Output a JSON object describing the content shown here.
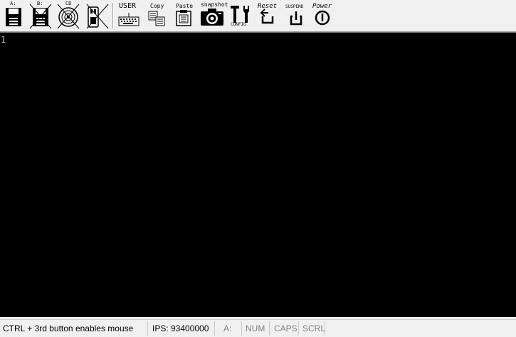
{
  "toolbar": {
    "floppy_a_label": "A:",
    "floppy_b_label": "B:",
    "cdrom_label": "CD",
    "user_label": "USER",
    "copy_label": "Copy",
    "paste_label": "Paste",
    "snapshot_label": "snapshot",
    "config_label": "CONFIG",
    "reset_label": "Reset",
    "suspend_label": "SUSPEND",
    "power_label": "Power"
  },
  "console": {
    "cursor": "1"
  },
  "statusbar": {
    "message": "CTRL + 3rd button enables mouse",
    "ips": "IPS: 93400000",
    "drive_indicator": "A:",
    "num_lock": "NUM",
    "caps_lock": "CAPS",
    "scroll_lock": "SCRL"
  },
  "colors": {
    "screen_background": "#000000",
    "toolbar_background": "#f0f0f0",
    "indicator_inactive": "#808080"
  },
  "icons": [
    "floppy-icon",
    "floppy-icon",
    "cdrom-icon",
    "usb-icon",
    "keyboard-icon",
    "copy-icon",
    "paste-icon",
    "camera-icon",
    "tools-icon",
    "reset-icon",
    "suspend-icon",
    "power-icon"
  ]
}
